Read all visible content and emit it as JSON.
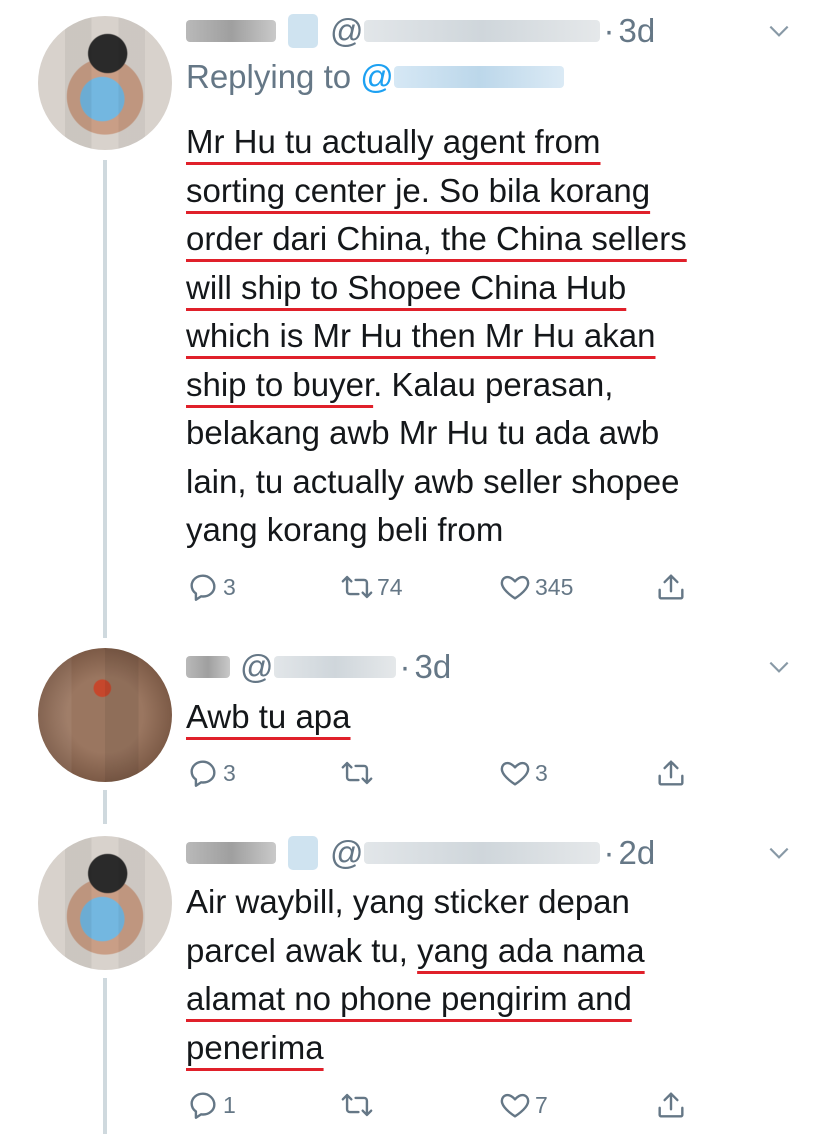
{
  "tweets": [
    {
      "time_sep": "·",
      "time": "3d",
      "reply_prefix": "Replying to",
      "reply_at": "@",
      "handle_at": "@",
      "lines": [
        {
          "segments": [
            {
              "t": "Mr Hu tu actually agent from",
              "u": true
            }
          ]
        },
        {
          "segments": [
            {
              "t": "sorting center je. So bila korang",
              "u": true
            }
          ]
        },
        {
          "segments": [
            {
              "t": "order dari China, the China sellers",
              "u": true
            }
          ]
        },
        {
          "segments": [
            {
              "t": "will ship to Shopee China Hub",
              "u": true
            }
          ]
        },
        {
          "segments": [
            {
              "t": "which is Mr Hu then Mr Hu akan",
              "u": true
            }
          ]
        },
        {
          "segments": [
            {
              "t": "ship to buyer",
              "u": true
            },
            {
              "t": ". Kalau perasan,",
              "u": false
            }
          ]
        },
        {
          "segments": [
            {
              "t": "belakang awb Mr Hu tu ada awb",
              "u": false
            }
          ]
        },
        {
          "segments": [
            {
              "t": "lain, tu actually awb seller shopee",
              "u": false
            }
          ]
        },
        {
          "segments": [
            {
              "t": "yang korang beli from",
              "u": false
            }
          ]
        }
      ],
      "counts": {
        "reply": "3",
        "retweet": "74",
        "like": "345"
      }
    },
    {
      "time_sep": "·",
      "time": "3d",
      "handle_at": "@",
      "lines": [
        {
          "segments": [
            {
              "t": "Awb tu apa",
              "u": true
            }
          ]
        }
      ],
      "counts": {
        "reply": "3",
        "retweet": "",
        "like": "3"
      }
    },
    {
      "time_sep": "·",
      "time": "2d",
      "handle_at": "@",
      "lines": [
        {
          "segments": [
            {
              "t": "Air waybill, yang sticker depan",
              "u": false
            }
          ]
        },
        {
          "segments": [
            {
              "t": "parcel awak tu, ",
              "u": false
            },
            {
              "t": "yang ada nama",
              "u": true
            }
          ]
        },
        {
          "segments": [
            {
              "t": "alamat no phone pengirim and",
              "u": true
            }
          ]
        },
        {
          "segments": [
            {
              "t": "penerima",
              "u": true
            }
          ]
        }
      ],
      "counts": {
        "reply": "1",
        "retweet": "",
        "like": "7"
      }
    }
  ],
  "icons": {
    "reply": "reply-icon",
    "retweet": "retweet-icon",
    "like": "heart-icon",
    "share": "share-icon",
    "more": "chevron-down-icon"
  },
  "colors": {
    "text": "#14171a",
    "meta": "#657786",
    "link": "#1da1f2",
    "underline_annotation": "#e0202a"
  }
}
